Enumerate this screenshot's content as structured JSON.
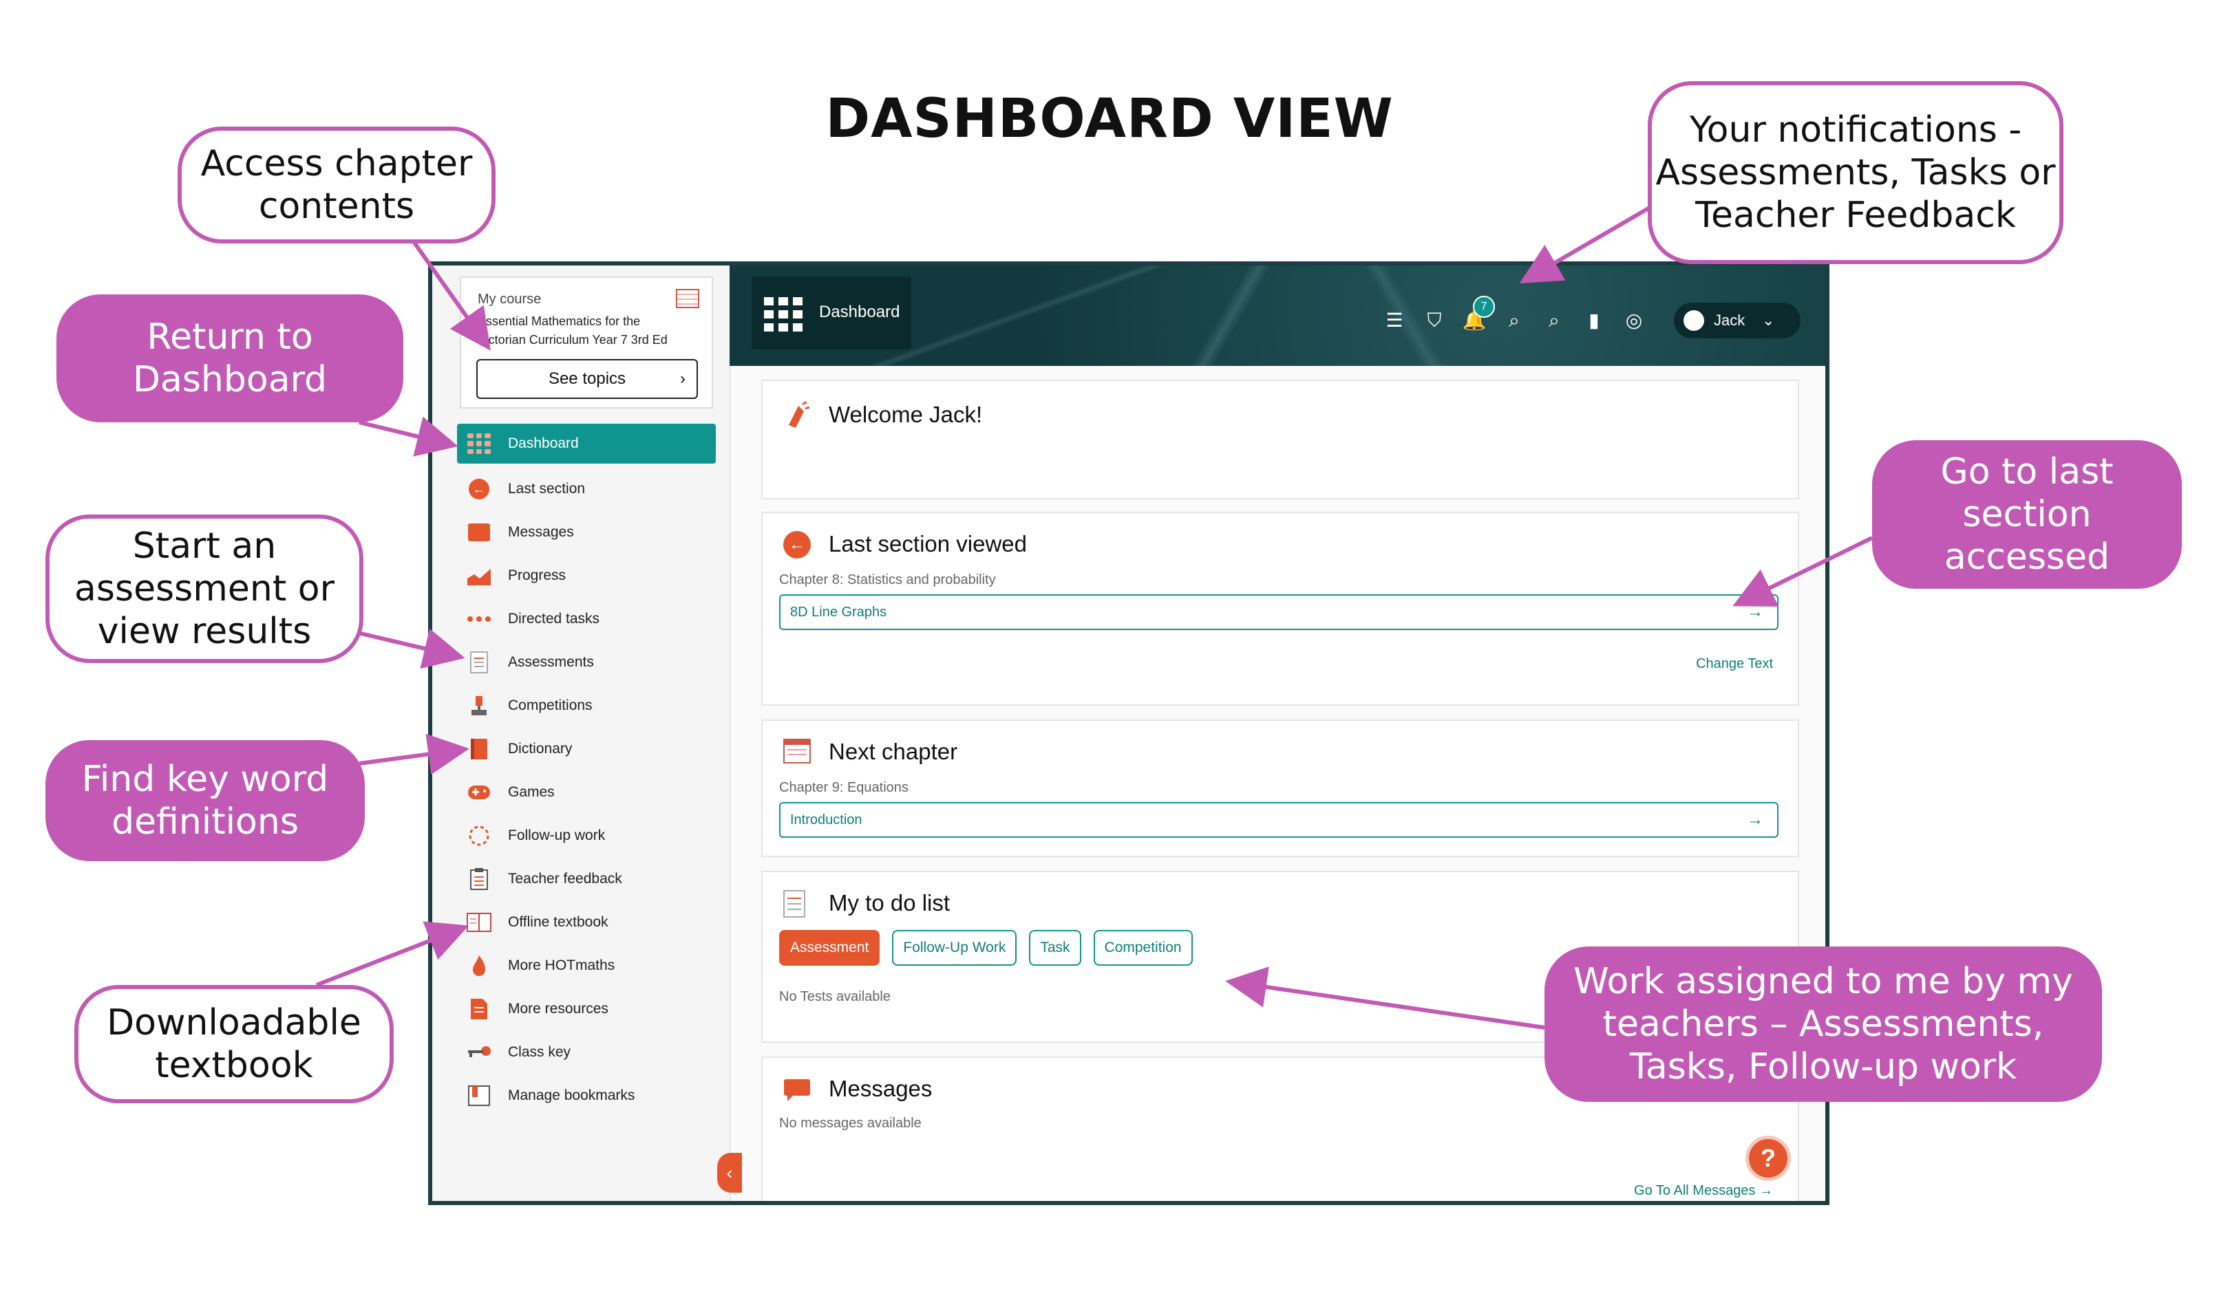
{
  "page_title": "DASHBOARD VIEW",
  "sidebar": {
    "course_label": "My course",
    "course_name": "Essential Mathematics for the Victorian Curriculum Year 7 3rd Ed",
    "see_topics": "See topics",
    "items": [
      {
        "label": "Dashboard",
        "icon": "dashboard-grid-icon",
        "active": true
      },
      {
        "label": "Last section",
        "icon": "back-arrow-icon"
      },
      {
        "label": "Messages",
        "icon": "message-icon"
      },
      {
        "label": "Progress",
        "icon": "chart-icon"
      },
      {
        "label": "Directed tasks",
        "icon": "tasks-icon"
      },
      {
        "label": "Assessments",
        "icon": "document-icon"
      },
      {
        "label": "Competitions",
        "icon": "trophy-icon"
      },
      {
        "label": "Dictionary",
        "icon": "book-icon"
      },
      {
        "label": "Games",
        "icon": "gamepad-icon"
      },
      {
        "label": "Follow-up work",
        "icon": "followup-icon"
      },
      {
        "label": "Teacher feedback",
        "icon": "clipboard-icon"
      },
      {
        "label": "Offline textbook",
        "icon": "textbook-icon"
      },
      {
        "label": "More HOTmaths",
        "icon": "flame-icon"
      },
      {
        "label": "More resources",
        "icon": "file-icon"
      },
      {
        "label": "Class key",
        "icon": "key-icon"
      },
      {
        "label": "Manage bookmarks",
        "icon": "bookmark-icon"
      }
    ]
  },
  "header": {
    "dashboard_label": "Dashboard",
    "notification_count": "7",
    "user_name": "Jack"
  },
  "cards": {
    "welcome": {
      "title": "Welcome Jack!"
    },
    "last_section": {
      "title": "Last section viewed",
      "subtitle": "Chapter 8: Statistics and probability",
      "link": "8D Line Graphs",
      "change_text": "Change Text"
    },
    "next_chapter": {
      "title": "Next chapter",
      "subtitle": "Chapter 9: Equations",
      "link": "Introduction"
    },
    "todo": {
      "title": "My to do list",
      "tabs": [
        "Assessment",
        "Follow-Up Work",
        "Task",
        "Competition"
      ],
      "empty": "No Tests available"
    },
    "messages": {
      "title": "Messages",
      "empty": "No messages available",
      "all_link": "Go To All Messages →"
    }
  },
  "callouts": {
    "chapter_contents": "Access chapter contents",
    "return_dashboard": "Return to Dashboard",
    "assessment": "Start an assessment or view results",
    "key_word": "Find key word definitions",
    "textbook": "Downloadable textbook",
    "notifications": "Your notifications - Assessments, Tasks or Teacher Feedback",
    "last_section": "Go to last section accessed",
    "work_assigned": "Work assigned to me by my teachers – Assessments, Tasks, Follow-up work"
  },
  "colors": {
    "accent": "#0f9490",
    "brand_orange": "#e4572e",
    "callout_pink": "#c25ab5",
    "header_dark": "#123a3e"
  }
}
